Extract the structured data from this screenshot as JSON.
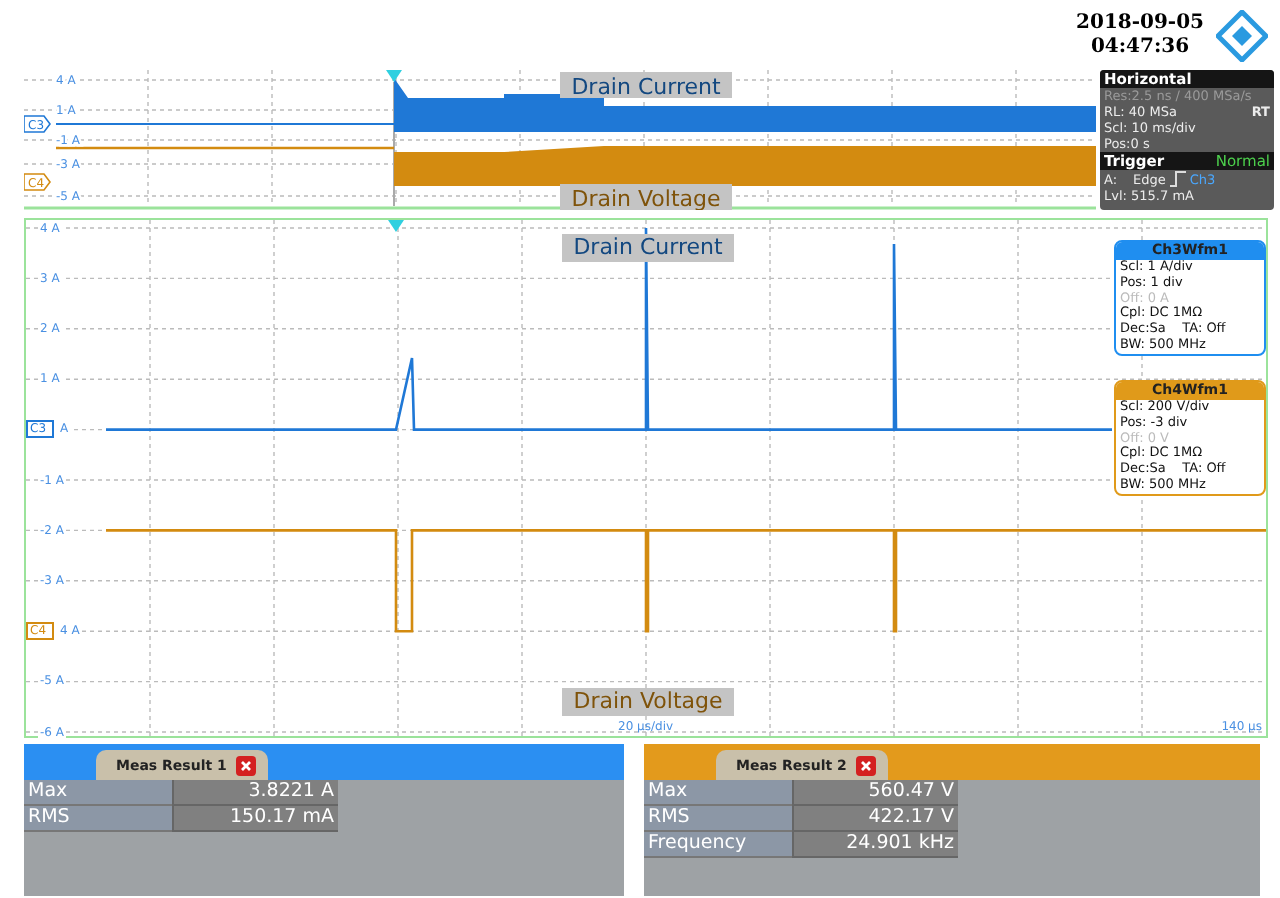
{
  "header": {
    "date": "2018-09-05",
    "time": "04:47:36"
  },
  "overview": {
    "axis_labels": [
      "4 A",
      "1 A",
      "-1 A",
      "-3 A",
      "-5 A"
    ],
    "channels": [
      {
        "marker": "C3",
        "name": "Drain Current",
        "color": "#1f78d6"
      },
      {
        "marker": "C4",
        "name": "Drain Voltage",
        "color": "#d38b10"
      }
    ]
  },
  "horizontal": {
    "title": "Horizontal",
    "lines": [
      {
        "text": "Res:2.5 ns / 400 MSa/s",
        "dim": true
      },
      {
        "text": "RL: 40 MSa",
        "dim": false,
        "tag": "RT"
      },
      {
        "text": "Scl: 10 ms/div",
        "dim": false
      },
      {
        "text": "Pos:0 s",
        "dim": false
      }
    ]
  },
  "trigger": {
    "title": "Trigger",
    "mode": "Normal",
    "label": "A:",
    "type": "Edge",
    "source": "Ch3",
    "level": "Lvl: 515.7 mA"
  },
  "main_plot": {
    "rows": [
      {
        "label": "4 A"
      },
      {
        "label": "3 A"
      },
      {
        "label": "2 A"
      },
      {
        "label": "1 A"
      },
      {
        "label": "A",
        "marker": "C3"
      },
      {
        "label": "-1 A"
      },
      {
        "label": "-2 A"
      },
      {
        "label": "-3 A"
      },
      {
        "label": "4 A",
        "marker": "C4"
      },
      {
        "label": "-5 A"
      },
      {
        "label": "-6 A"
      }
    ],
    "channels": [
      {
        "name": "Drain Current",
        "color": "#1f78d6"
      },
      {
        "name": "Drain Voltage",
        "color": "#d38b10"
      }
    ],
    "x_scale": "20 µs/div",
    "x_end": "140 µs"
  },
  "channel_boxes": [
    {
      "title": "Ch3Wfm1",
      "color": "#1f8ef0",
      "lines": [
        {
          "text": "Scl: 1 A/div",
          "dim": false
        },
        {
          "text": "Pos: 1 div",
          "dim": false
        },
        {
          "text": "Off: 0 A",
          "dim": true
        },
        {
          "text": "Cpl: DC 1MΩ",
          "dim": false
        },
        {
          "text": "Dec:Sa    TA: Off",
          "dim": false
        },
        {
          "text": "BW: 500 MHz",
          "dim": false
        }
      ]
    },
    {
      "title": "Ch4Wfm1",
      "color": "#e09a1a",
      "lines": [
        {
          "text": "Scl: 200 V/div",
          "dim": false
        },
        {
          "text": "Pos: -3 div",
          "dim": false
        },
        {
          "text": "Off: 0 V",
          "dim": true
        },
        {
          "text": "Cpl: DC 1MΩ",
          "dim": false
        },
        {
          "text": "Dec:Sa    TA: Off",
          "dim": false
        },
        {
          "text": "BW: 500 MHz",
          "dim": false
        }
      ]
    }
  ],
  "measurements": [
    {
      "title": "Meas Result 1",
      "color": "#2b8ff2",
      "rows": [
        {
          "label": "Max",
          "value": "3.8221 A"
        },
        {
          "label": "RMS",
          "value": "150.17 mA"
        }
      ]
    },
    {
      "title": "Meas Result 2",
      "color": "#e39a1c",
      "rows": [
        {
          "label": "Max",
          "value": "560.47 V"
        },
        {
          "label": "RMS",
          "value": "422.17 V"
        },
        {
          "label": "Frequency",
          "value": "24.901 kHz"
        }
      ]
    }
  ]
}
